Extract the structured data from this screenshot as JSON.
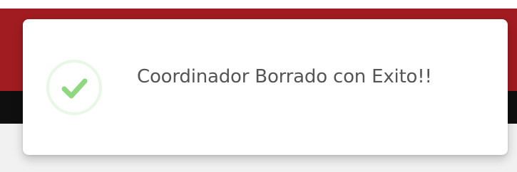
{
  "toast": {
    "icon": "check-icon",
    "message": "Coordinador Borrado con Exito!!"
  },
  "colors": {
    "header_primary": "#a01c20",
    "header_secondary": "#0f0f0f",
    "success": "#8fd87f",
    "text": "#555555"
  }
}
